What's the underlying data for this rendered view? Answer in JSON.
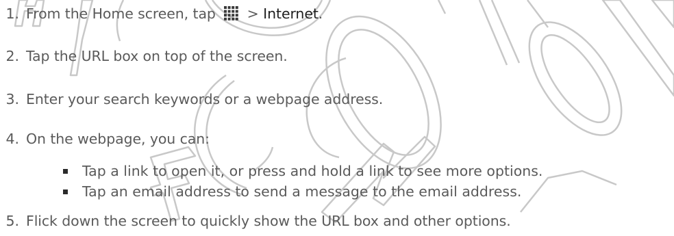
{
  "steps": [
    {
      "number": "1.",
      "prefix": "From the Home screen, tap",
      "icon": "apps-grid-icon",
      "separator": ">",
      "target": "Internet",
      "suffix": "."
    },
    {
      "number": "2.",
      "text": "Tap the URL box on top of the screen."
    },
    {
      "number": "3.",
      "text": "Enter your search keywords or a webpage address."
    },
    {
      "number": "4.",
      "text": "On the webpage, you can:"
    },
    {
      "number": "5.",
      "text": "Flick down the screen to quickly show the URL box and other options."
    }
  ],
  "sub_items": [
    {
      "text": "Tap a link to open it, or press and hold a link to see more options."
    },
    {
      "text": "Tap an email address to send a message to the email address."
    }
  ],
  "watermark": {
    "description": "HTC CONFIDENTIAL FCC",
    "color": "#c8c8c8"
  },
  "colors": {
    "body_text": "#5a5a5a",
    "emphasis_text": "#1e1e1e",
    "icon": "#3a3a3a"
  }
}
